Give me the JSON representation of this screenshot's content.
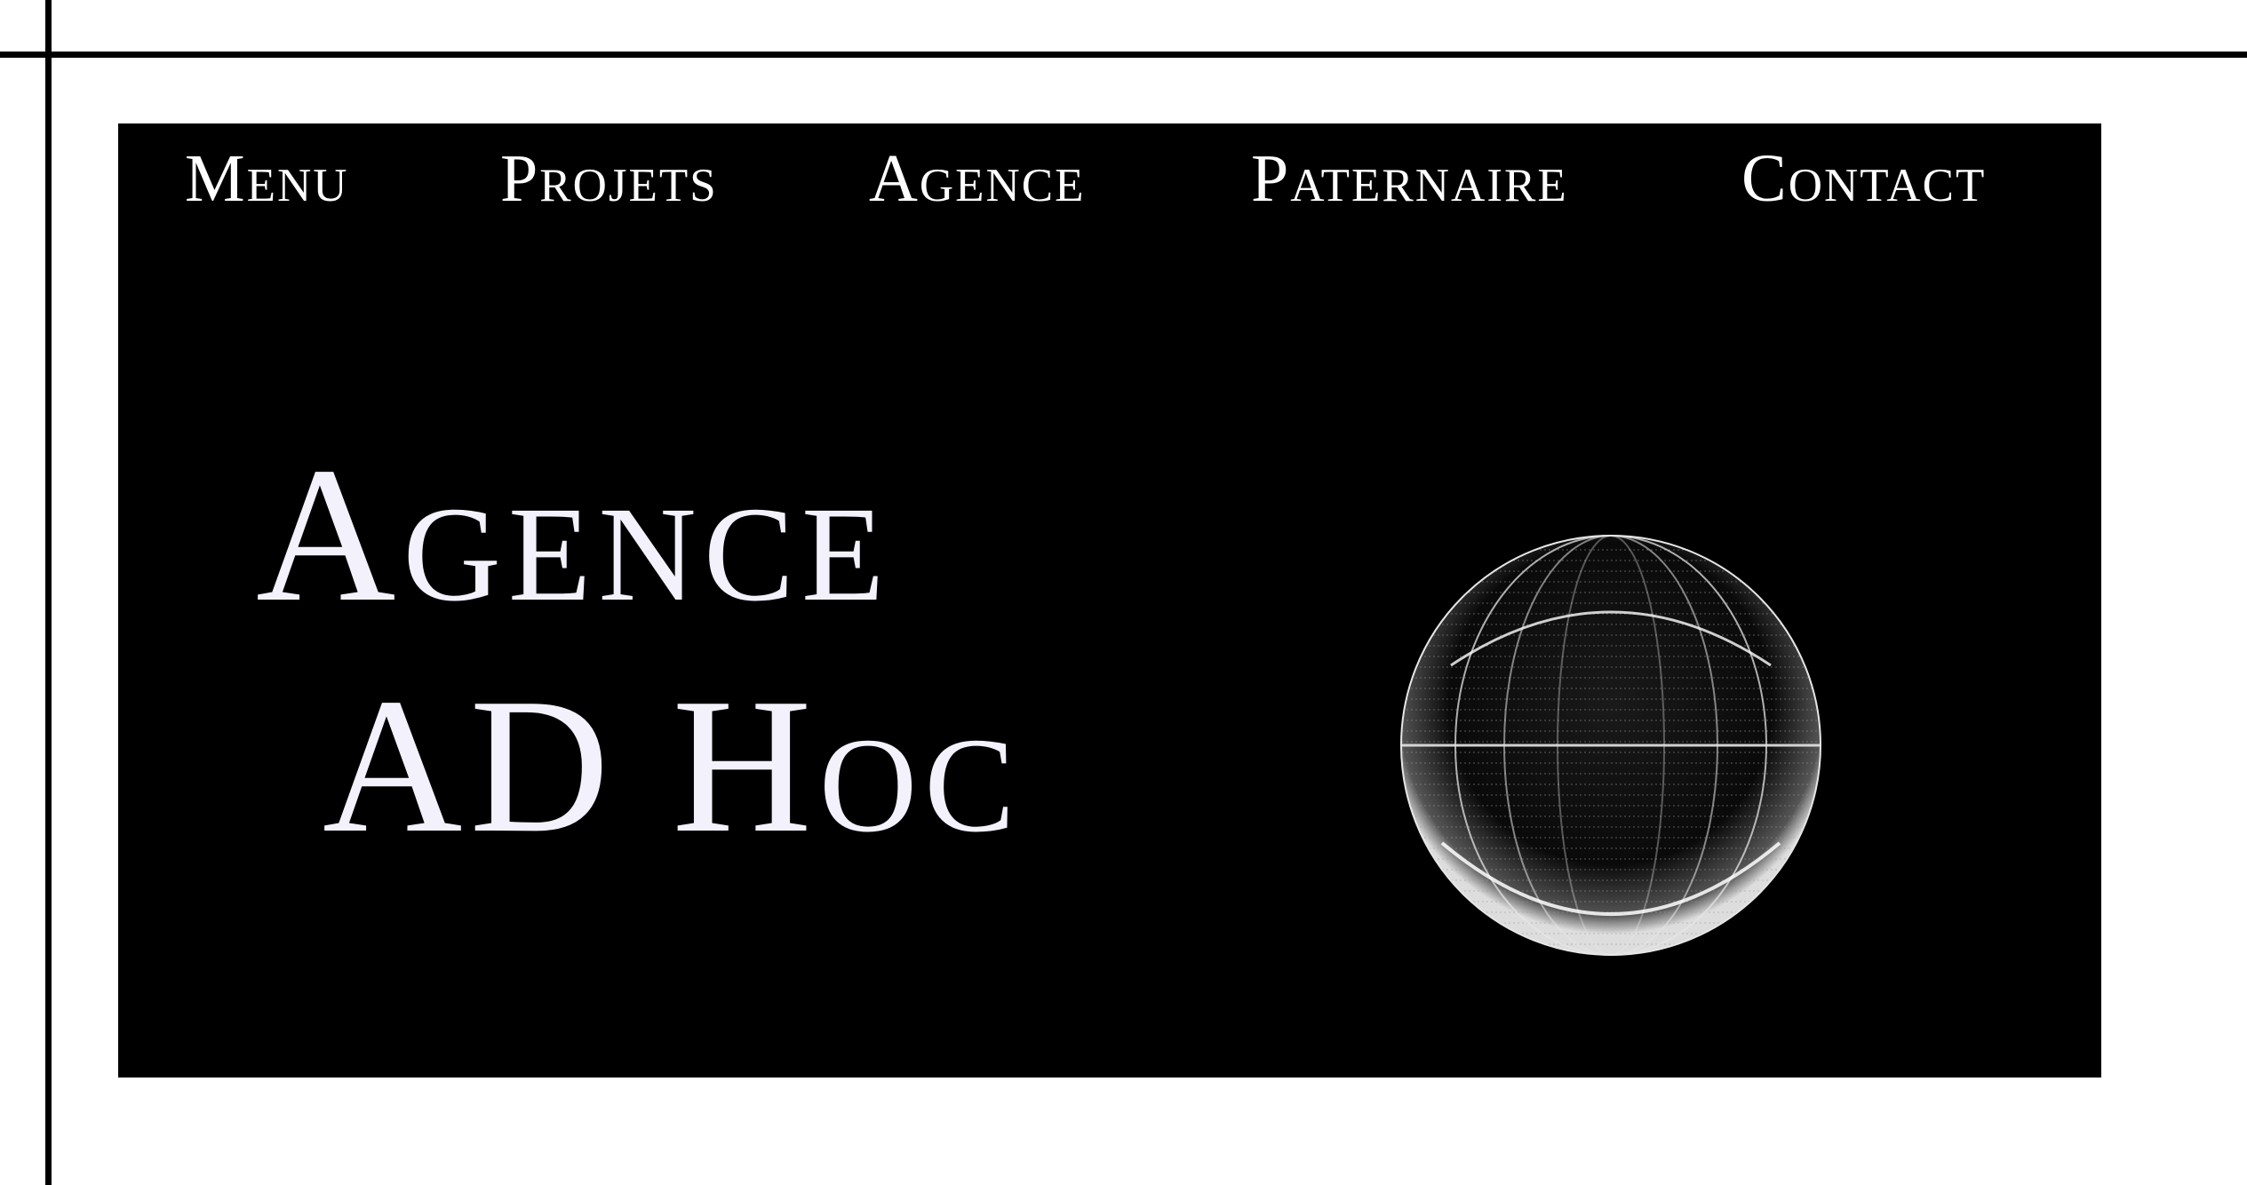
{
  "nav": {
    "items": [
      {
        "label": "Menu"
      },
      {
        "label": "Projets"
      },
      {
        "label": "Agence"
      },
      {
        "label": "Paternaire"
      },
      {
        "label": "Contact"
      }
    ]
  },
  "hero": {
    "title_line1": "Agence",
    "title_line2": "AD Hoc",
    "image_icon": "wireframe-sphere",
    "background": "#000000",
    "text_color": "#f3f1fb"
  }
}
